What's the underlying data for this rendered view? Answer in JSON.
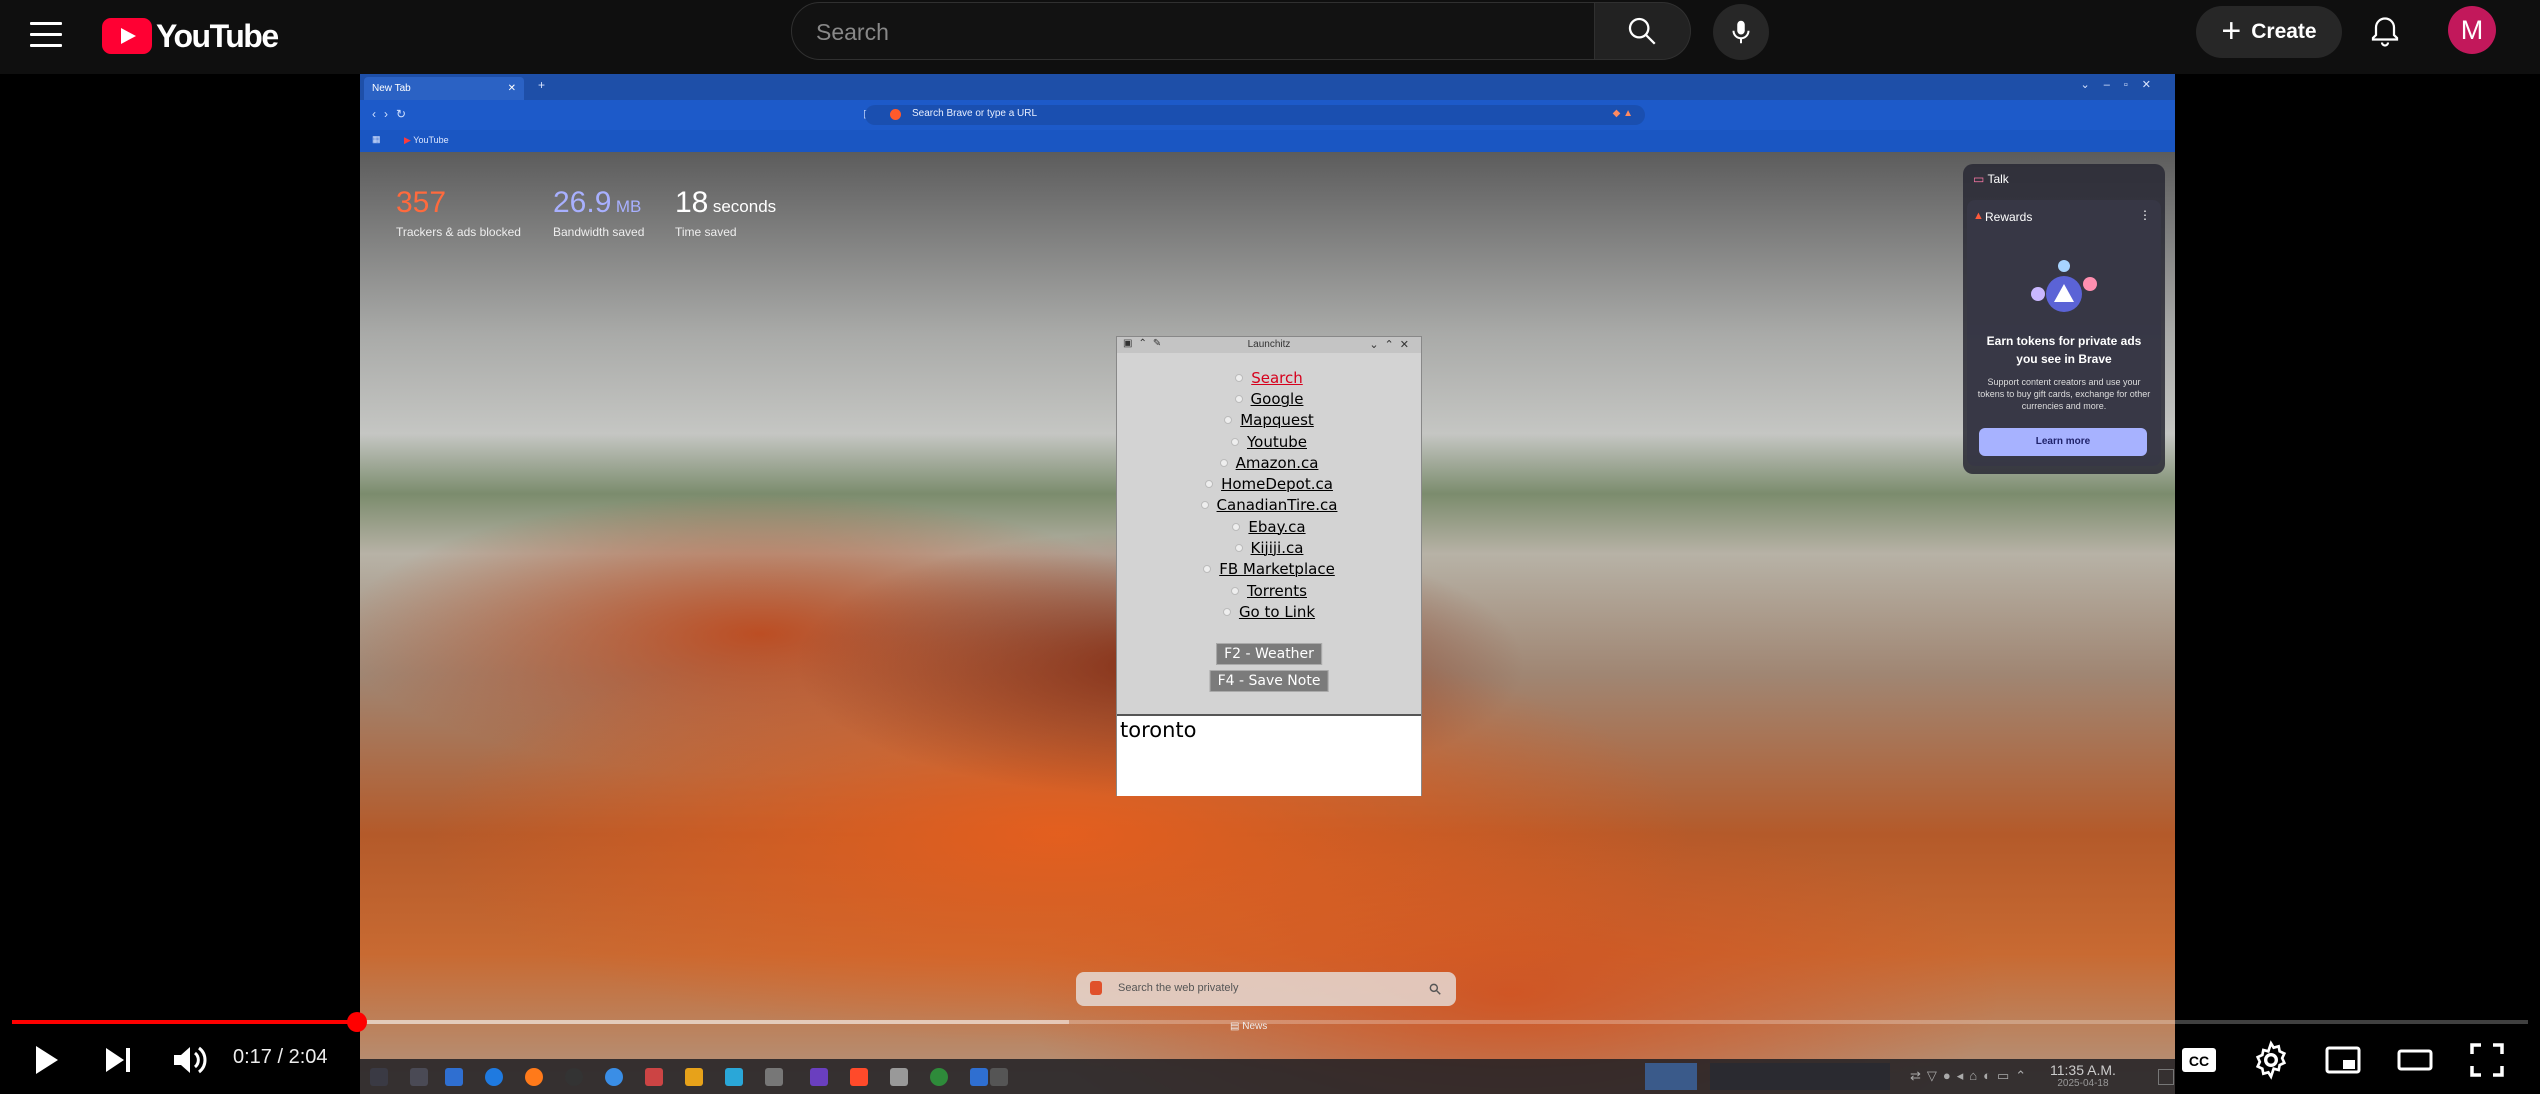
{
  "header": {
    "logo_text": "YouTube",
    "search_placeholder": "Search",
    "create_label": "Create",
    "avatar_letter": "M"
  },
  "browser": {
    "tab_title": "New Tab",
    "url_placeholder": "Search Brave or type a URL",
    "bookmark": "YouTube",
    "stats": [
      {
        "value": "357",
        "unit": "",
        "label": "Trackers & ads blocked",
        "color": "#ff6a3d"
      },
      {
        "value": "26.9",
        "unit": "MB",
        "label": "Bandwidth saved",
        "color": "#a8b0ff"
      },
      {
        "value": "18",
        "unit": "seconds",
        "label": "Time saved",
        "color": "#ffffff"
      }
    ],
    "talk": "Talk",
    "rewards": {
      "title": "Rewards",
      "heading": "Earn tokens for private ads you see in Brave",
      "desc": "Support content creators and use your tokens to buy gift cards, exchange for other currencies and more.",
      "button": "Learn more"
    },
    "search_placeholder": "Search the web privately",
    "news": "News"
  },
  "launchitz": {
    "title": "Launchitz",
    "options": [
      "Search",
      "Google",
      "Mapquest",
      "Youtube",
      "Amazon.ca",
      "HomeDepot.ca",
      "CanadianTire.ca",
      "Ebay.ca",
      "Kijiji.ca",
      "FB Marketplace",
      "Torrents",
      "Go to Link"
    ],
    "selected": "Search",
    "weather_button": "F2 - Weather",
    "note_button": "F4 - Save Note",
    "entry_text": "toronto"
  },
  "taskbar": {
    "time": "11:35 A.M.",
    "date": "2025-04-18"
  },
  "player": {
    "time_display": "0:17 / 2:04",
    "progress": 0.137,
    "buffered": 0.42
  }
}
